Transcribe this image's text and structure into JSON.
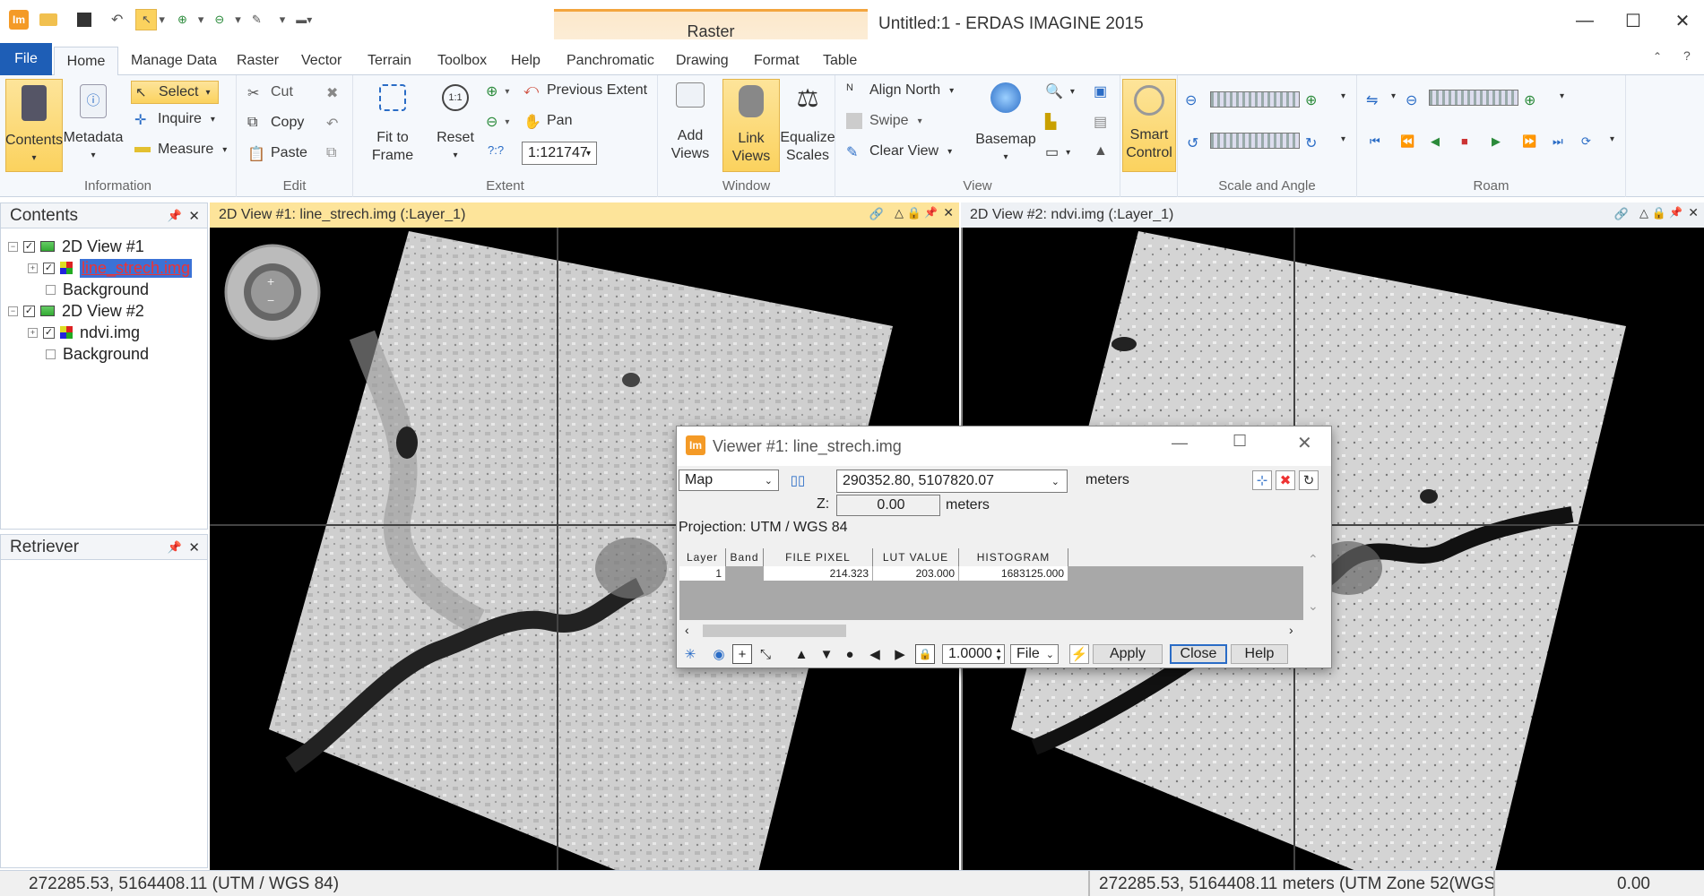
{
  "app": {
    "title": "Untitled:1 - ERDAS IMAGINE 2015",
    "logo": "Im"
  },
  "window_controls": {
    "minimize": "—",
    "maximize": "☐",
    "close": "✕"
  },
  "tabs": [
    "File",
    "Home",
    "Manage Data",
    "Raster",
    "Vector",
    "Terrain",
    "Toolbox",
    "Help",
    "Panchromatic",
    "Drawing",
    "Format",
    "Table"
  ],
  "context_tab": "Raster",
  "ribbon": {
    "information": {
      "label": "Information",
      "contents": "Contents",
      "metadata": "Metadata",
      "select": "Select",
      "inquire": "Inquire",
      "measure": "Measure"
    },
    "edit": {
      "label": "Edit",
      "cut": "Cut",
      "copy": "Copy",
      "paste": "Paste"
    },
    "extent": {
      "label": "Extent",
      "fit": "Fit to Frame",
      "reset": "Reset",
      "previous": "Previous Extent",
      "pan": "Pan",
      "scale": "1:121747",
      "unknown": "?:?"
    },
    "window": {
      "label": "Window",
      "add_views": "Add Views",
      "link_views": "Link Views",
      "equalize": "Equalize Scales"
    },
    "view": {
      "label": "View",
      "align_north": "Align North",
      "swipe": "Swipe",
      "clear_view": "Clear View",
      "basemap": "Basemap"
    },
    "smart": {
      "label": "Smart Control"
    },
    "scale_angle": {
      "label": "Scale and Angle"
    },
    "roam": {
      "label": "Roam"
    }
  },
  "contents_panel": {
    "title": "Contents",
    "items": [
      {
        "label": "2D View #1"
      },
      {
        "label": "line_strech.img"
      },
      {
        "label": "Background"
      },
      {
        "label": "2D View #2"
      },
      {
        "label": "ndvi.img"
      },
      {
        "label": "Background"
      }
    ]
  },
  "retriever_panel": {
    "title": "Retriever"
  },
  "views": [
    {
      "title": "2D View #1: line_strech.img (:Layer_1)"
    },
    {
      "title": "2D View #2: ndvi.img (:Layer_1)"
    }
  ],
  "viewer_dialog": {
    "title": "Viewer #1:   line_strech.img",
    "coord_type": "Map",
    "coords": "290352.80,  5107820.07",
    "units": "meters",
    "z_label": "Z:",
    "z_value": "0.00",
    "z_units": "meters",
    "projection": "Projection:  UTM / WGS 84",
    "table": {
      "headers": [
        "Layer",
        "Band",
        "FILE PIXEL",
        "LUT VALUE",
        "HISTOGRAM"
      ],
      "row": [
        "1",
        "",
        "214.323",
        "203.000",
        "1683125.000"
      ]
    },
    "zoom_value": "1.0000",
    "file_select": "File",
    "apply": "Apply",
    "close": "Close",
    "help": "Help"
  },
  "status": {
    "left": "272285.53, 5164408.11   (UTM / WGS 84)",
    "mid": "272285.53, 5164408.11 meters (UTM Zone 52(WGS",
    "right": "0.00"
  }
}
